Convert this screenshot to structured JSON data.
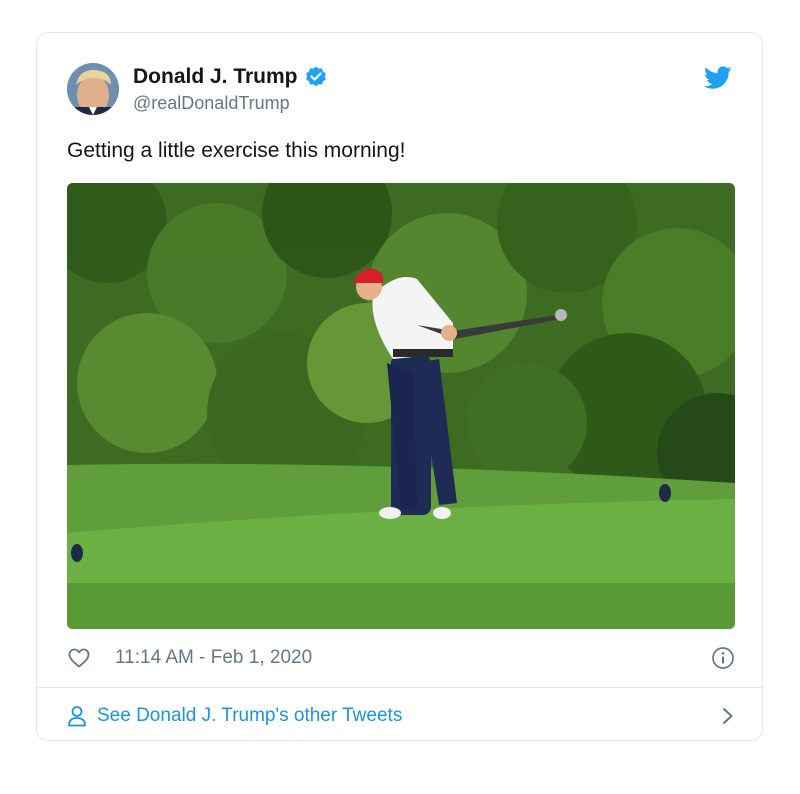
{
  "tweet": {
    "author_name": "Donald J. Trump",
    "author_handle": "@realDonaldTrump",
    "text": "Getting a little exercise this morning!",
    "timestamp": "11:14 AM - Feb 1, 2020",
    "see_more_label": "See Donald J. Trump's other Tweets"
  },
  "colors": {
    "brand_blue": "#1da1f2",
    "link_blue": "#1b95e0",
    "secondary_text": "#657786",
    "border": "#e1e8ed"
  },
  "icons": {
    "verified": "verified-badge-icon",
    "logo": "twitter-bird-icon",
    "like": "heart-icon",
    "info": "info-icon",
    "profile": "person-icon",
    "next": "chevron-right-icon"
  }
}
